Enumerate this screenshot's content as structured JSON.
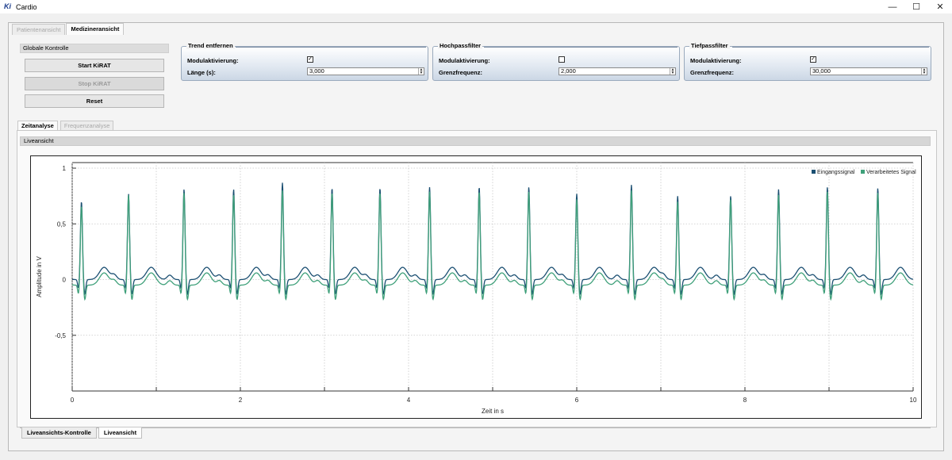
{
  "window": {
    "title": "Cardio",
    "icon": "ki-logo-icon",
    "controls": {
      "minimize": "—",
      "maximize": "☐",
      "close": "✕"
    }
  },
  "top_tabs": [
    {
      "label": "Patientenansicht",
      "active": false
    },
    {
      "label": "Medizineransicht",
      "active": true
    }
  ],
  "global_control": {
    "header": "Globale Kontrolle",
    "buttons": [
      {
        "label": "Start KiRAT",
        "enabled": true
      },
      {
        "label": "Stop KiRAT",
        "enabled": false
      },
      {
        "label": "Reset",
        "enabled": true
      }
    ]
  },
  "filters": {
    "trend": {
      "title": "Trend entfernen",
      "module_label": "Modulaktivierung:",
      "module_checked": true,
      "param_label": "Länge (s):",
      "param_value": "3,000"
    },
    "highpass": {
      "title": "Hochpassfilter",
      "module_label": "Modulaktivierung:",
      "module_checked": false,
      "param_label": "Grenzfrequenz:",
      "param_value": "2,000"
    },
    "lowpass": {
      "title": "Tiefpassfilter",
      "module_label": "Modulaktivierung:",
      "module_checked": true,
      "param_label": "Grenzfrequenz:",
      "param_value": "30,000"
    }
  },
  "analysis_tabs": [
    {
      "label": "Zeitanalyse",
      "active": true
    },
    {
      "label": "Frequenzanalyse",
      "active": false
    }
  ],
  "live_header": "Liveansicht",
  "bottom_tabs": [
    {
      "label": "Liveansichts-Kontrolle",
      "active": false
    },
    {
      "label": "Liveansicht",
      "active": true
    }
  ],
  "chart_data": {
    "type": "line",
    "xlabel": "Zeit in s",
    "ylabel": "Amplitude in V",
    "xlim": [
      0,
      10
    ],
    "ylim": [
      -1,
      1.05
    ],
    "xticks": [
      0,
      2,
      4,
      6,
      8,
      10
    ],
    "xtick_labels": [
      "0",
      "2",
      "4",
      "6",
      "8",
      "10"
    ],
    "yticks": [
      1,
      0.5,
      0,
      -0.5
    ],
    "ytick_labels": [
      "1",
      "0,5",
      "0",
      "-0,5"
    ],
    "grid": true,
    "legend_position": "top-right",
    "series": [
      {
        "name": "Eingangssignal",
        "color": "#1b4f72",
        "baseline": 0.0,
        "r_peak_times": [
          0.11,
          0.67,
          1.33,
          1.92,
          2.5,
          3.09,
          3.66,
          4.25,
          4.84,
          5.43,
          6.0,
          6.65,
          7.2,
          7.83,
          8.4,
          8.98,
          9.58
        ],
        "r_peak_values": [
          0.7,
          0.77,
          0.81,
          0.81,
          0.87,
          0.82,
          0.82,
          0.83,
          0.83,
          0.83,
          0.77,
          0.85,
          0.75,
          0.75,
          0.81,
          0.83,
          0.82
        ]
      },
      {
        "name": "Verarbeitetes Signal",
        "color": "#3fa07a",
        "baseline": -0.05,
        "r_peak_times": [
          0.11,
          0.67,
          1.33,
          1.92,
          2.5,
          3.09,
          3.66,
          4.25,
          4.84,
          5.43,
          6.0,
          6.65,
          7.2,
          7.83,
          8.4,
          8.98,
          9.58
        ],
        "r_peak_values": [
          0.66,
          0.76,
          0.78,
          0.76,
          0.8,
          0.78,
          0.78,
          0.79,
          0.79,
          0.79,
          0.72,
          0.8,
          0.7,
          0.72,
          0.76,
          0.79,
          0.78
        ]
      }
    ]
  }
}
